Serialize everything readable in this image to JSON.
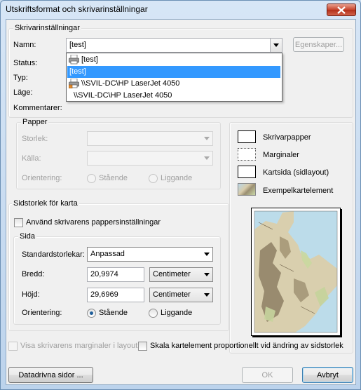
{
  "window": {
    "title": "Utskriftsformat och skrivarinställningar"
  },
  "printer": {
    "group_label": "Skrivarinställningar",
    "name_label": "Namn:",
    "name_value": "[test]",
    "properties_button": "Egenskaper...",
    "status_label": "Status:",
    "type_label": "Typ:",
    "location_label": "Läge:",
    "comments_label": "Kommentarer:",
    "dropdown_items": [
      {
        "label": "[test]",
        "icon": "printer-icon"
      },
      {
        "label": "[test]",
        "selected": true
      },
      {
        "label": "\\\\SVIL-DC\\HP LaserJet 4050",
        "icon": "network-printer-icon"
      },
      {
        "label": "\\\\SVIL-DC\\HP LaserJet 4050"
      }
    ]
  },
  "paper": {
    "group_label": "Papper",
    "size_label": "Storlek:",
    "source_label": "Källa:",
    "orientation_label": "Orientering:",
    "portrait": "Stående",
    "landscape": "Liggande"
  },
  "legend": {
    "printer_paper": "Skrivarpapper",
    "margins": "Marginaler",
    "page": "Kartsida (sidlayout)",
    "sample": "Exempelkartelement"
  },
  "map_page": {
    "group_label": "Sidstorlek för karta",
    "use_printer_settings": "Använd skrivarens pappersinställningar",
    "page_group_label": "Sida",
    "standard_sizes_label": "Standardstorlekar:",
    "standard_sizes_value": "Anpassad",
    "width_label": "Bredd:",
    "width_value": "20,9974",
    "width_unit": "Centimeter",
    "height_label": "Höjd:",
    "height_value": "29,6969",
    "height_unit": "Centimeter",
    "orientation_label": "Orientering:",
    "portrait": "Stående",
    "landscape": "Liggande"
  },
  "options": {
    "show_printer_margins": "Visa skrivarens marginaler i layout",
    "scale_elements": "Skala kartelement proportionellt vid ändring av sidstorlek"
  },
  "buttons": {
    "data_driven": "Datadrivna sidor ...",
    "ok": "OK",
    "cancel": "Avbryt"
  }
}
